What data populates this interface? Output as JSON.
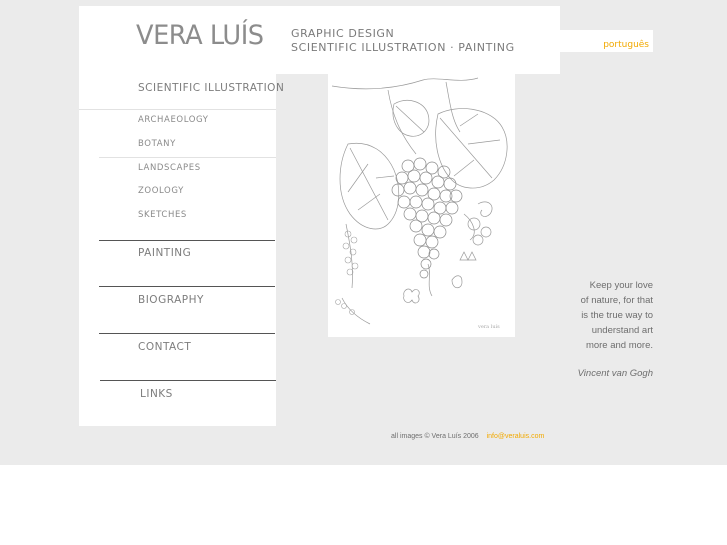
{
  "header": {
    "name": "VERA LUÍS",
    "tagline_line1": "GRAPHIC DESIGN",
    "tagline_line2": "SCIENTIFIC ILLUSTRATION · PAINTING"
  },
  "language_link": "português",
  "nav": {
    "section": "SCIENTIFIC ILLUSTRATION",
    "sub_items": [
      "ARCHAEOLOGY",
      "BOTANY",
      "LANDSCAPES",
      "ZOOLOGY",
      "SKETCHES"
    ],
    "main_items": [
      "PAINTING",
      "BIOGRAPHY",
      "CONTACT",
      "LINKS"
    ]
  },
  "artwork": {
    "signature": "vera luís"
  },
  "quote": {
    "lines": [
      "Keep your love",
      "of nature, for that",
      "is the true way to",
      "understand art",
      "more and more."
    ],
    "author": "Vincent van Gogh"
  },
  "footer": {
    "copyright": "all images © Vera Luís 2006",
    "email": "info@veraluis.com"
  },
  "colors": {
    "accent": "#f2a900",
    "background": "#ebebeb",
    "text": "#7d7d7d"
  }
}
